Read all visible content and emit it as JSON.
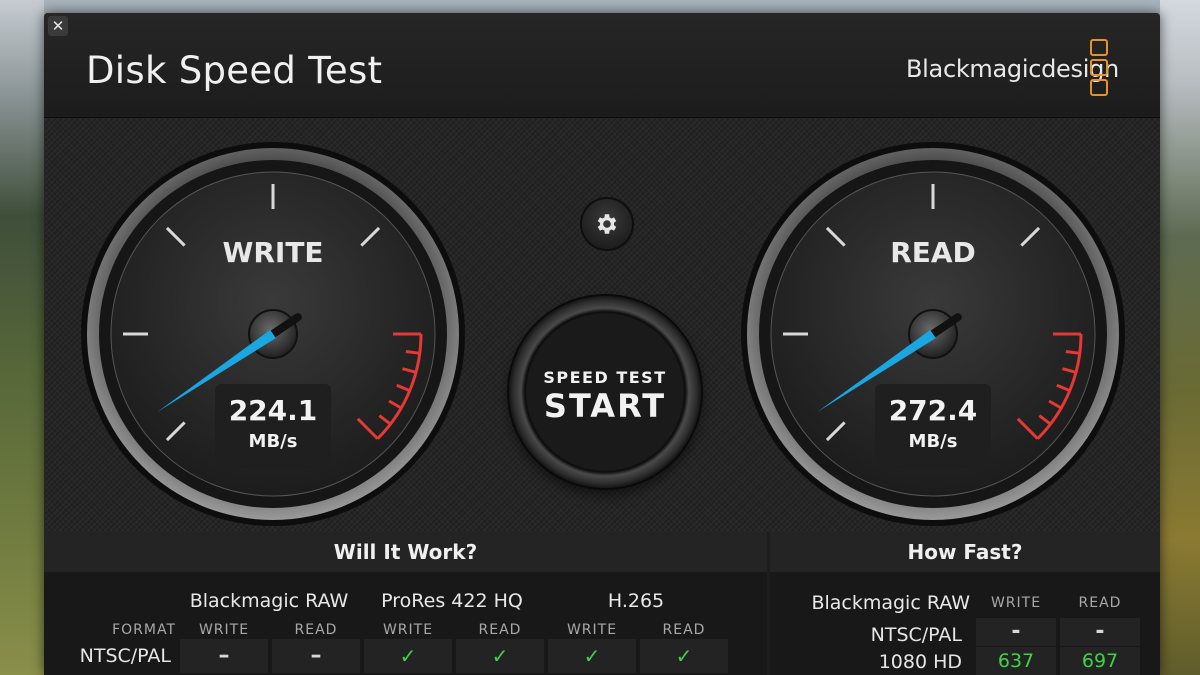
{
  "window": {
    "close_glyph": "✕",
    "title": "Disk Speed Test",
    "brand": "Blackmagicdesign",
    "brand_color": "#e8912a"
  },
  "gauges": {
    "write": {
      "label": "WRITE",
      "value": "224.1",
      "unit": "MB/s",
      "needle_color": "#1aa6e0",
      "redline_color": "#e53935"
    },
    "read": {
      "label": "READ",
      "value": "272.4",
      "unit": "MB/s",
      "needle_color": "#1aa6e0",
      "redline_color": "#e53935"
    }
  },
  "controls": {
    "settings_icon": "gear-icon",
    "start_small": "SPEED TEST",
    "start_big": "START"
  },
  "will_it_work": {
    "title": "Will It Work?",
    "format_label": "FORMAT",
    "codecs": [
      {
        "name": "Blackmagic RAW",
        "write": "WRITE",
        "read": "READ"
      },
      {
        "name": "ProRes 422 HQ",
        "write": "WRITE",
        "read": "READ"
      },
      {
        "name": "H.265",
        "write": "WRITE",
        "read": "READ"
      }
    ],
    "rows": [
      {
        "format": "NTSC/PAL",
        "cells": [
          "–",
          "–",
          "✓",
          "✓",
          "✓",
          "✓"
        ]
      }
    ]
  },
  "how_fast": {
    "title": "How Fast?",
    "codec": "Blackmagic RAW",
    "write_label": "WRITE",
    "read_label": "READ",
    "rows": [
      {
        "format": "NTSC/PAL",
        "write": "-",
        "read": "-"
      },
      {
        "format": "1080 HD",
        "write": "637",
        "read": "697"
      }
    ]
  }
}
